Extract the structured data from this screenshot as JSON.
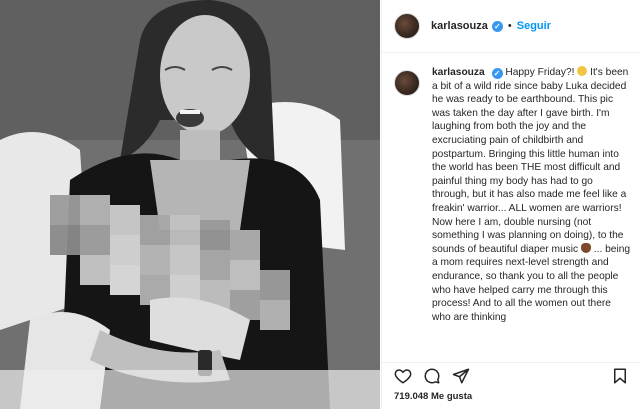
{
  "post": {
    "username": "karlasouza",
    "follow_label": "Seguir",
    "separator": "•",
    "verified_mark": "✓",
    "caption_lines": [
      "Happy Friday?!",
      "It's been a bit of a wild ride since baby Luka decided he was ready to be earthbound. This pic was taken the day after I gave birth. I'm laughing from both the joy and the excruciating pain of childbirth and postpartum. Bringing this little human into the world has been THE most difficult and painful thing my body has had to go through, but it has also made me feel like a freakin' warrior... ALL women are warriors! Now here I am, double nursing (not something I was planning on doing), to the sounds of beautiful diaper music",
      "... being a mom requires next-level strength and endurance, so thank you to all the people who have helped carry me through this process! And to all the women out there who are thinking"
    ],
    "likes_text": "719.048 Me gusta"
  },
  "icons": {
    "like": "heart-icon",
    "comment": "comment-icon",
    "share": "share-icon",
    "save": "bookmark-icon",
    "emoji_1": "grinning-sweat-emoji",
    "emoji_2": "poop-emoji"
  },
  "colors": {
    "accent": "#0095f6",
    "verified": "#3897f0",
    "text": "#262626",
    "border": "#efefef"
  }
}
